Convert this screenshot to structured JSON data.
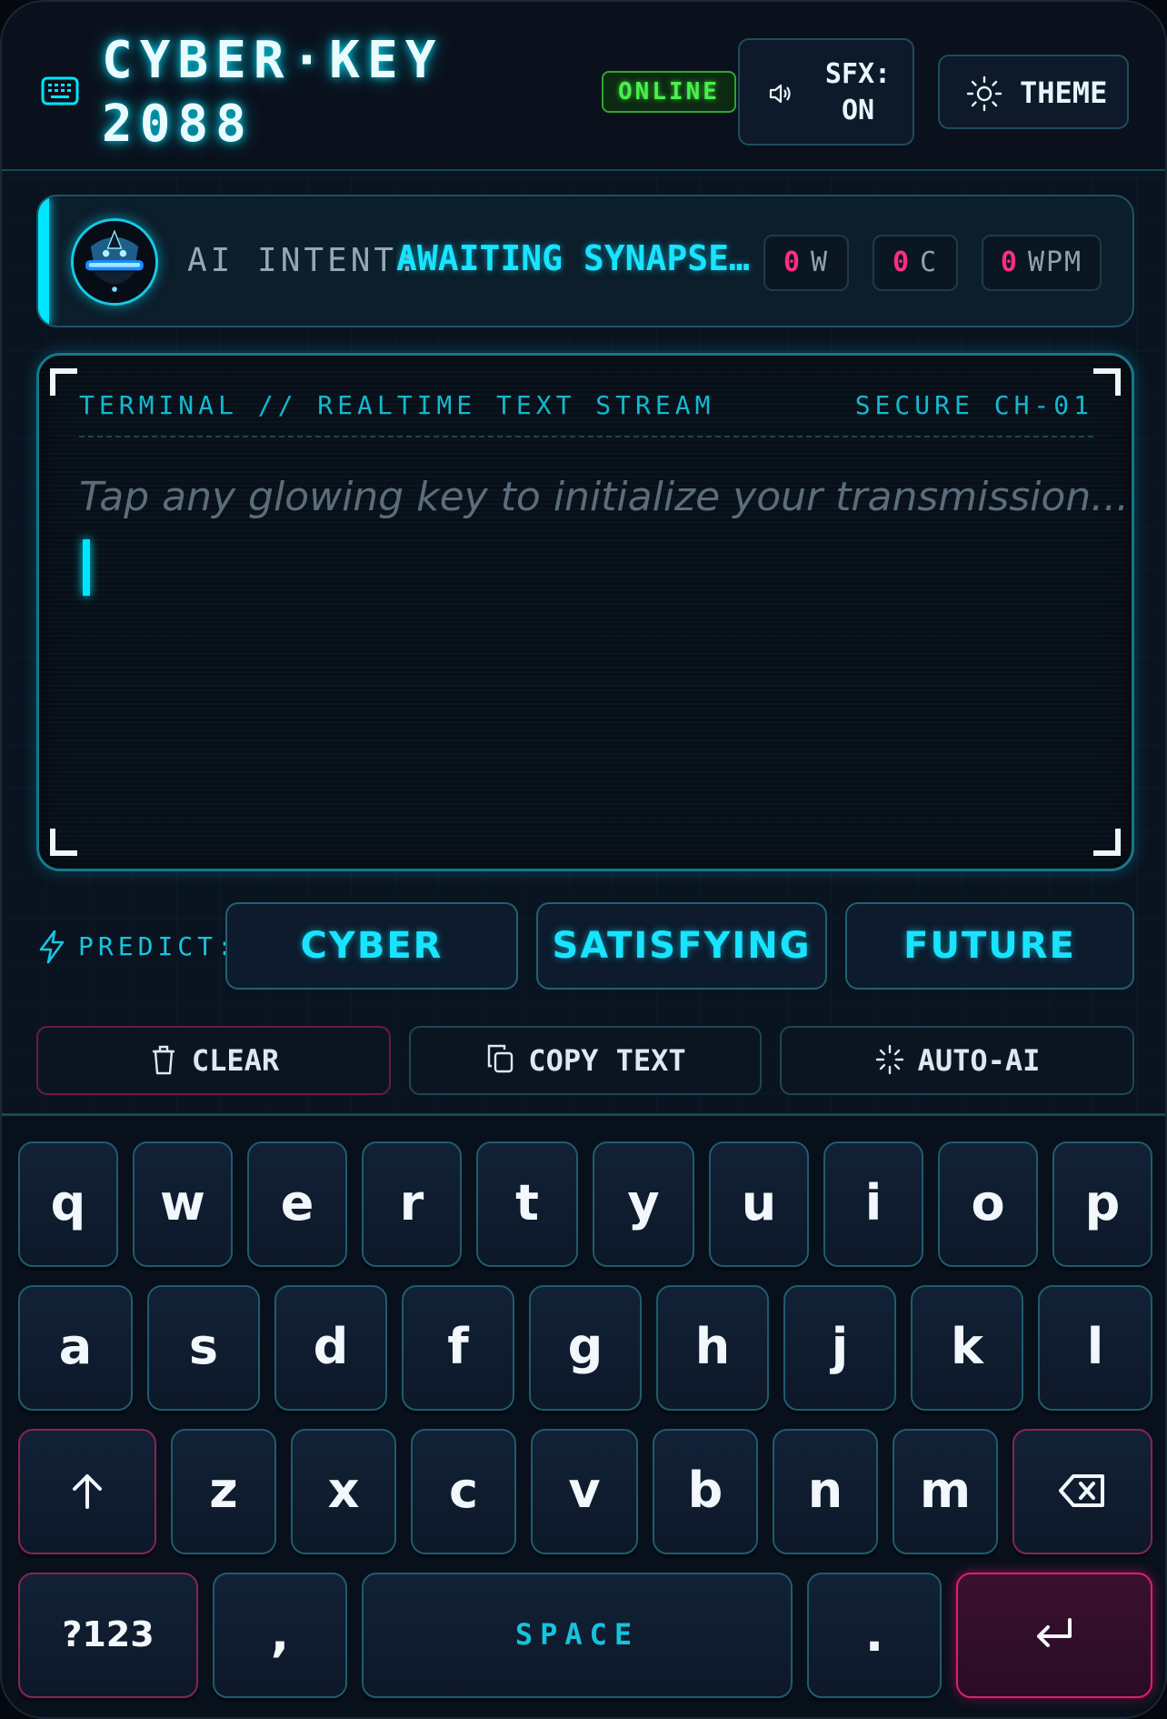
{
  "header": {
    "title": "CYBER·KEY\n2088",
    "status": "ONLINE",
    "sfx_label": "SFX:\nON",
    "theme_label": "THEME",
    "icons": [
      "keyboard-icon",
      "speaker-icon",
      "sun-icon"
    ]
  },
  "intent": {
    "label": "AI INTENT:",
    "value": "AWAITING SYNAPSE INPUT",
    "stats": [
      {
        "value": "0",
        "unit": "W"
      },
      {
        "value": "0",
        "unit": "C"
      },
      {
        "value": "0",
        "unit": "WPM"
      }
    ]
  },
  "terminal": {
    "header": "TERMINAL // REALTIME TEXT STREAM",
    "channel": "SECURE CH-01",
    "placeholder": "Tap any glowing key to initialize your transmission..."
  },
  "predict": {
    "label": "PREDICT:",
    "suggestions": [
      "CYBER",
      "SATISFYING",
      "FUTURE"
    ]
  },
  "actions": {
    "clear": "CLEAR",
    "copy": "COPY TEXT",
    "auto": "AUTO-AI"
  },
  "keyboard": {
    "row1": [
      "q",
      "w",
      "e",
      "r",
      "t",
      "y",
      "u",
      "i",
      "o",
      "p"
    ],
    "row2": [
      "a",
      "s",
      "d",
      "f",
      "g",
      "h",
      "j",
      "k",
      "l"
    ],
    "row3": [
      "z",
      "x",
      "c",
      "v",
      "b",
      "n",
      "m"
    ],
    "numbers_key": "?123",
    "comma_key": ",",
    "space_key": "SPACE",
    "period_key": "."
  },
  "colors": {
    "accent": "#00e5ff",
    "alert": "#ff2d84",
    "online": "#4bf04b",
    "background": "#0a1320"
  }
}
